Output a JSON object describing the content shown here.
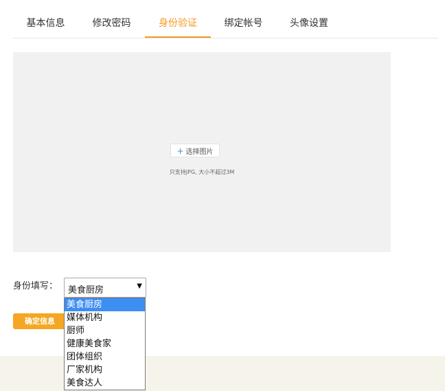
{
  "tabs": [
    {
      "label": "基本信息",
      "active": false
    },
    {
      "label": "修改密码",
      "active": false
    },
    {
      "label": "身份验证",
      "active": true
    },
    {
      "label": "绑定帐号",
      "active": false
    },
    {
      "label": "头像设置",
      "active": false
    }
  ],
  "upload": {
    "choose_icon": "plus-icon",
    "choose_label": "选择图片",
    "hint": "只支持JPG, 大小不超过3M"
  },
  "identity": {
    "label": "身份填写：",
    "selected": "美食厨房",
    "arrow_icon": "caret-down-icon",
    "options": [
      "美食厨房",
      "媒体机构",
      "厨师",
      "健康美食家",
      "团体组织",
      "厂家机构",
      "美食达人"
    ]
  },
  "confirm_label": "确定信息",
  "colors": {
    "accent": "#f39a1d",
    "button": "#f5a623",
    "highlight": "#3c8ef3",
    "upload_bg": "#f1f1f2",
    "footer_bg": "#f6f3ea"
  }
}
